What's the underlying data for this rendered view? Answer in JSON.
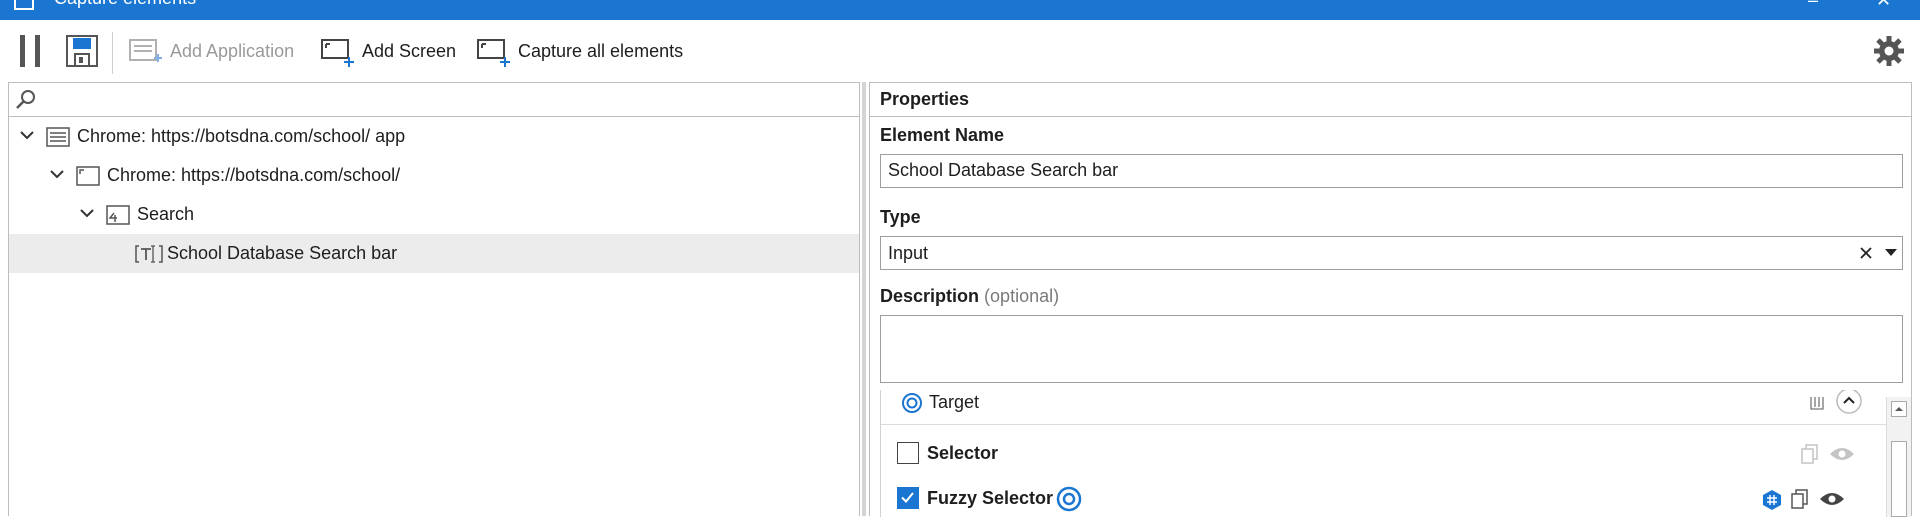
{
  "window": {
    "title": "Capture elements"
  },
  "toolbar": {
    "add_application": "Add Application",
    "add_screen": "Add Screen",
    "capture_all": "Capture all elements"
  },
  "tree": {
    "items": [
      {
        "label": "Chrome: https://botsdna.com/school/ app",
        "icon": "application-icon"
      },
      {
        "label": "Chrome: https://botsdna.com/school/",
        "icon": "screen-icon"
      },
      {
        "label": "Search",
        "icon": "ui-element-icon"
      },
      {
        "label": "School Database Search bar",
        "icon": "text-input-icon",
        "selected": true
      }
    ]
  },
  "properties": {
    "header": "Properties",
    "element_name_label": "Element Name",
    "element_name_value": "School Database Search bar",
    "type_label": "Type",
    "type_value": "Input",
    "description_label": "Description",
    "description_optional": "(optional)",
    "description_value": "",
    "target_label": "Target",
    "selector_label": "Selector",
    "selector_checked": false,
    "fuzzy_selector_label": "Fuzzy Selector",
    "fuzzy_selector_checked": true
  },
  "colors": {
    "accent": "#1b76d2",
    "selected_row": "#ececec"
  }
}
